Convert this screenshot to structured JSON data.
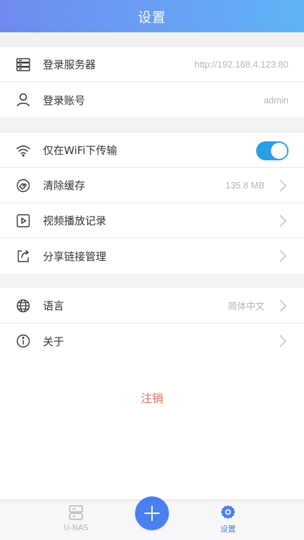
{
  "header": {
    "title": "设置"
  },
  "server_group": {
    "server": {
      "label": "登录服务器",
      "value": "http://192.168.4.123:80",
      "icon": "server-icon"
    },
    "account": {
      "label": "登录账号",
      "value": "admin",
      "icon": "user-icon"
    }
  },
  "transfer_group": {
    "wifi_only": {
      "label": "仅在WiFi下传输",
      "enabled": true,
      "icon": "wifi-icon"
    },
    "clear_cache": {
      "label": "清除缓存",
      "value": "135.8 MB",
      "icon": "clear-cache-icon"
    },
    "video_history": {
      "label": "视频播放记录",
      "icon": "video-play-icon"
    },
    "share_links": {
      "label": "分享链接管理",
      "icon": "share-icon"
    }
  },
  "misc_group": {
    "language": {
      "label": "语言",
      "value": "简体中文",
      "icon": "globe-icon"
    },
    "about": {
      "label": "关于",
      "icon": "info-icon"
    }
  },
  "logout": {
    "label": "注销"
  },
  "tabbar": {
    "unas": {
      "label": "U-NAS",
      "icon": "nas-icon"
    },
    "add": {
      "icon": "plus-icon"
    },
    "settings": {
      "label": "设置",
      "icon": "gear-icon"
    }
  },
  "colors": {
    "accent": "#4a7ff0",
    "toggle_on": "#2b9ee8",
    "logout": "#f26a62",
    "header_start": "#6d8af0",
    "header_end": "#5fb4f6"
  }
}
